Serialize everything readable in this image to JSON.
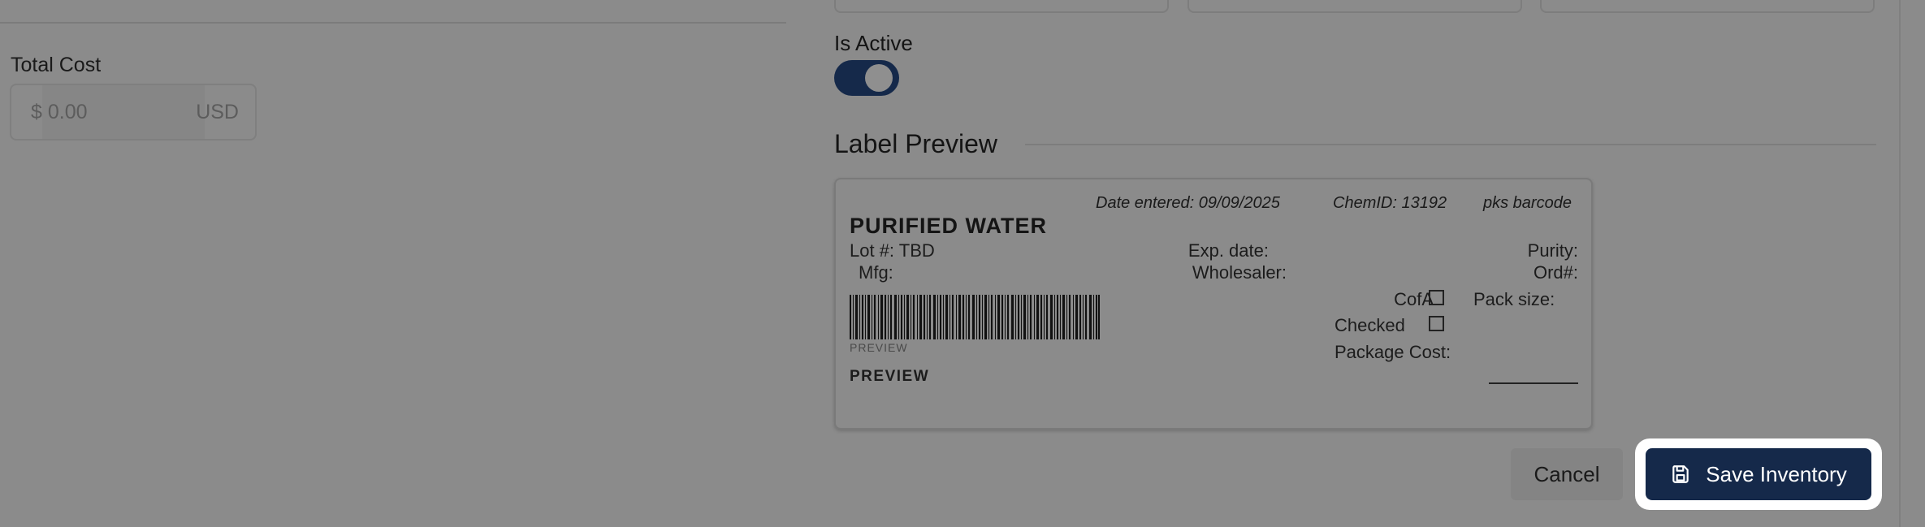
{
  "total_cost": {
    "label": "Total Cost",
    "placeholder": "$ 0.00",
    "currency": "USD"
  },
  "is_active": {
    "label": "Is Active",
    "on": true
  },
  "label_preview": {
    "title": "Label Preview",
    "date_entered": "Date entered: 09/09/2025",
    "chem_id": "ChemID: 13192",
    "barcode_label": "pks barcode",
    "product_name": "PURIFIED WATER",
    "lot": "Lot #: TBD",
    "mfg": "Mfg:",
    "exp_date": "Exp. date:",
    "wholesaler": "Wholesaler:",
    "purity": "Purity:",
    "ord": "Ord#:",
    "cofa": "CofA",
    "pack_size": "Pack size:",
    "checked": "Checked",
    "package_cost": "Package Cost:",
    "barcode_caption": "PREVIEW",
    "preview_text": "PREVIEW"
  },
  "actions": {
    "cancel": "Cancel",
    "save": "Save Inventory"
  },
  "colors": {
    "overlay_bg": "#8b8b8b",
    "primary": "#15294a",
    "focus_ring": "#ffffff"
  },
  "icons": {
    "save": "floppy-disk-icon"
  }
}
